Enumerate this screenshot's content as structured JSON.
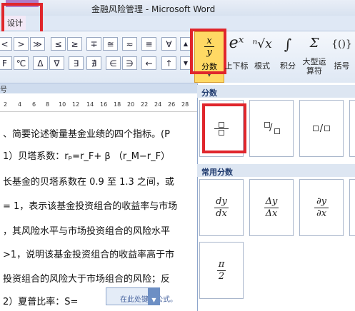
{
  "window": {
    "title": "金融风险管理 - Microsoft Word",
    "context_tab": "设计"
  },
  "ribbon": {
    "symbols_row1": [
      "<",
      "≫",
      "≤",
      "≥",
      "∓",
      "≅",
      "≈",
      "≡",
      "∀"
    ],
    "symbols_row2": [
      "F",
      "℃",
      "Δ",
      "∇",
      "∃",
      "∄",
      "∈",
      "∋",
      "←",
      "↑"
    ],
    "group_label": "号",
    "buttons": [
      {
        "id": "fraction",
        "glyph": "x/y",
        "label": "分数"
      },
      {
        "id": "script",
        "glyph": "eˣ",
        "label": "上下标"
      },
      {
        "id": "radical",
        "glyph": "ⁿ√x",
        "label": "根式"
      },
      {
        "id": "integral",
        "glyph": "∫",
        "label": "积分"
      },
      {
        "id": "large-operator",
        "glyph": "Σ",
        "label": "大型运算符"
      },
      {
        "id": "bracket",
        "glyph": "{()}",
        "label": "括号"
      }
    ]
  },
  "ruler": {
    "ticks": [
      "2",
      "4",
      "6",
      "8",
      "10",
      "12",
      "14",
      "16",
      "18",
      "20",
      "22",
      "24",
      "26",
      "28"
    ]
  },
  "document": {
    "lines": [
      "、简要论述衡量基金业绩的四个指标。(P",
      "1）贝塔系数：rₚ=r_F+ β （r_M−r_F）",
      "长基金的贝塔系数在 0.9 至 1.3 之间，或",
      "= 1，表示该基金投资组合的收益率与市场",
      "，其风险水平与市场投资组合的风险水平",
      ">1，说明该基金投资组合的收益率高于市",
      "投资组合的风险大于市场组合的风险；反",
      "2）夏普比率：S="
    ],
    "equation_placeholder": "在此处键入公式。"
  },
  "dropdown": {
    "section_fraction": "分数",
    "section_common": "常用分数",
    "common_fractions": [
      {
        "num": "dy",
        "den": "dx"
      },
      {
        "num": "Δy",
        "den": "Δx"
      },
      {
        "num": "∂y",
        "den": "∂x"
      },
      {
        "num": "δy",
        "den": "δx"
      },
      {
        "num": "π",
        "den": "2"
      }
    ]
  },
  "colors": {
    "highlight": "#e0262c",
    "fraction_button": "#ffd964",
    "section_bg": "#dde6f2"
  }
}
